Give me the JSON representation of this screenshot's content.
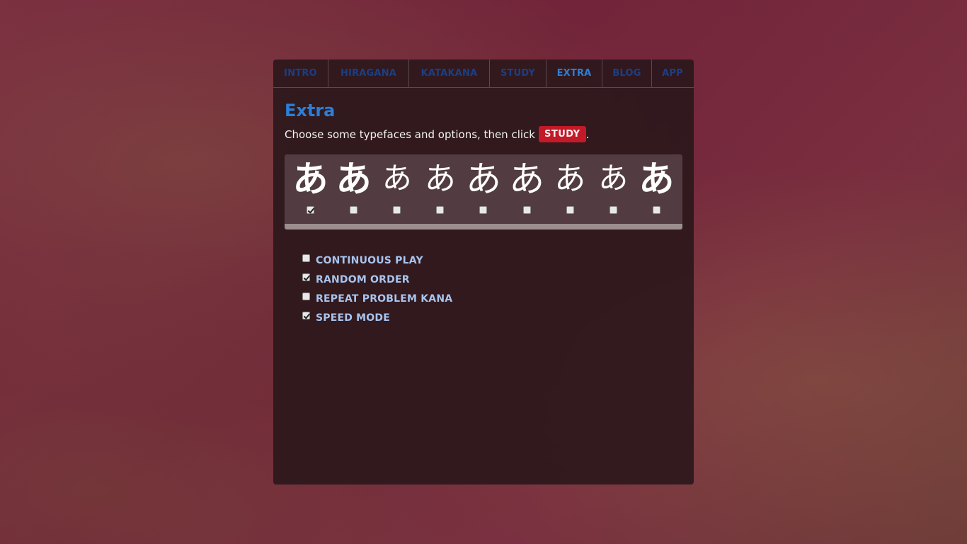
{
  "nav": {
    "tabs": [
      {
        "label": "INTRO"
      },
      {
        "label": "HIRAGANA"
      },
      {
        "label": "KATAKANA"
      },
      {
        "label": "STUDY"
      },
      {
        "label": "EXTRA"
      },
      {
        "label": "BLOG"
      },
      {
        "label": "APP"
      }
    ],
    "active": "EXTRA",
    "color": "#1a3f86",
    "active_color": "#2a7fd8"
  },
  "main": {
    "title": "Extra",
    "intro_text": "Choose some typefaces and options, then click",
    "intro_button": "STUDY",
    "intro_end": ".",
    "button_color": "#c41a28"
  },
  "typefaces": [
    {
      "glyph": "あ",
      "checked": true
    },
    {
      "glyph": "あ",
      "checked": false
    },
    {
      "glyph": "あ",
      "checked": false
    },
    {
      "glyph": "あ",
      "checked": false
    },
    {
      "glyph": "あ",
      "checked": false
    },
    {
      "glyph": "あ",
      "checked": false
    },
    {
      "glyph": "あ",
      "checked": false
    },
    {
      "glyph": "あ",
      "checked": false
    },
    {
      "glyph": "あ",
      "checked": false
    }
  ],
  "options": [
    {
      "label": "CONTINUOUS PLAY",
      "checked": false
    },
    {
      "label": "RANDOM ORDER",
      "checked": true
    },
    {
      "label": "REPEAT PROBLEM KANA",
      "checked": false
    },
    {
      "label": "SPEED MODE",
      "checked": true
    }
  ]
}
